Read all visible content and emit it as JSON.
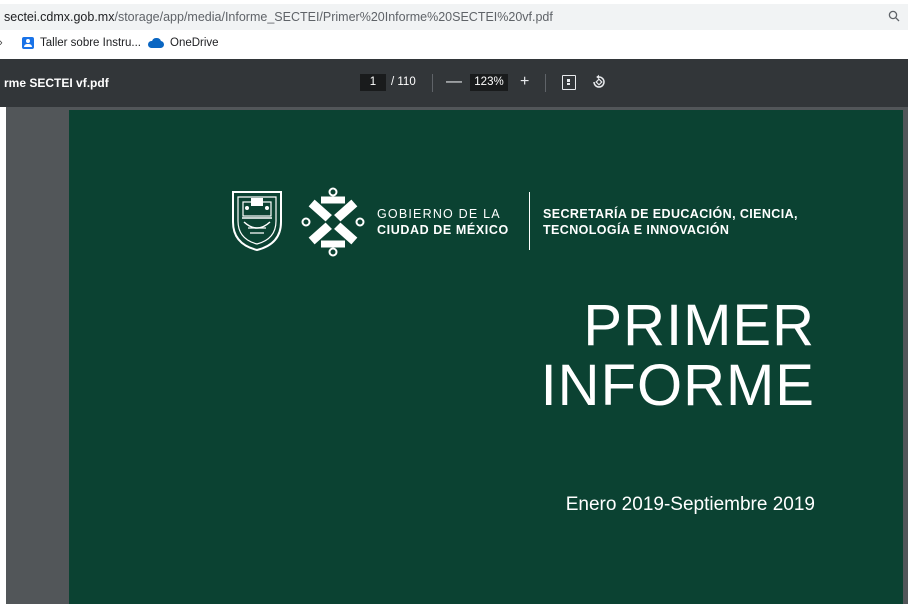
{
  "browser": {
    "url_host": "sectei.cdmx.gob.mx",
    "url_path": "/storage/app/media/Informe_SECTEI/Primer%20Informe%20SECTEI%20vf.pdf",
    "zoom_icon": "magnifier-icon"
  },
  "bookmarks": {
    "items": [
      {
        "label": "Taller sobre Instru...",
        "icon": "person-icon"
      },
      {
        "label": "OneDrive",
        "icon": "cloud-icon"
      }
    ]
  },
  "pdf_toolbar": {
    "filename": "rme SECTEI vf.pdf",
    "current_page": "1",
    "total_pages": "/ 110",
    "zoom_out": "—",
    "zoom_level": "123%",
    "zoom_in": "+",
    "fit_icon": "fit-page-icon",
    "rotate_icon": "rotate-icon"
  },
  "document": {
    "gov_line1": "GOBIERNO DE LA",
    "gov_line2": "CIUDAD DE MÉXICO",
    "secretaria_line1": "SECRETARÍA DE EDUCACIÓN, CIENCIA,",
    "secretaria_line2": "TECNOLOGÍA E INNOVACIÓN",
    "title_line1": "PRIMER",
    "title_line2": "INFORME",
    "period": "Enero 2019-Septiembre 2019",
    "background_color": "#0b4232"
  }
}
